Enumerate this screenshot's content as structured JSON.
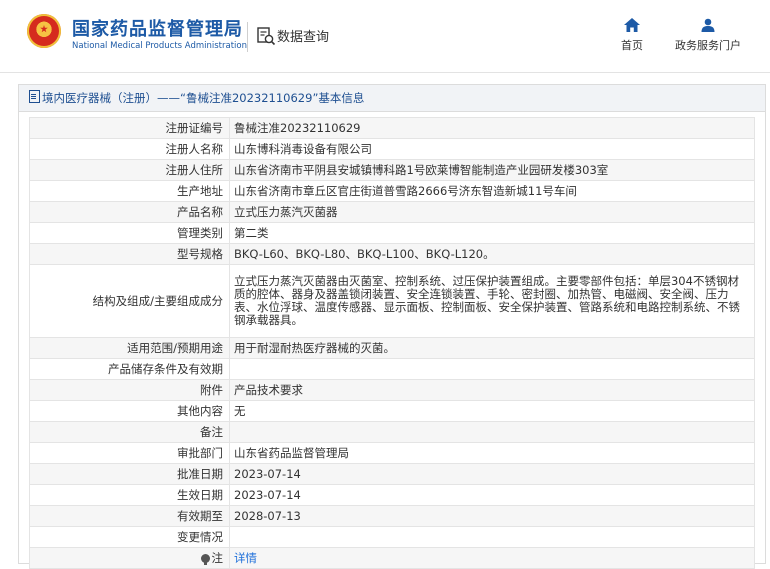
{
  "header": {
    "org_cn": "国家药品监督管理局",
    "org_en": "National Medical Products Administration",
    "query_label": "数据查询",
    "nav": {
      "home": "首页",
      "portal": "政务服务门户"
    }
  },
  "breadcrumb": "境内医疗器械（注册）——“鲁械注准20232110629”基本信息",
  "rows": [
    {
      "k": "注册证编号",
      "v": "鲁械注准20232110629"
    },
    {
      "k": "注册人名称",
      "v": "山东博科消毒设备有限公司"
    },
    {
      "k": "注册人住所",
      "v": "山东省济南市平阴县安城镇博科路1号欧莱博智能制造产业园研发楼303室"
    },
    {
      "k": "生产地址",
      "v": "山东省济南市章丘区官庄街道普雪路2666号济东智造新城11号车间"
    },
    {
      "k": "产品名称",
      "v": "立式压力蒸汽灭菌器"
    },
    {
      "k": "管理类别",
      "v": "第二类"
    },
    {
      "k": "型号规格",
      "v": "BKQ-L60、BKQ-L80、BKQ-L100、BKQ-L120。"
    },
    {
      "k": "结构及组成/主要组成成分",
      "v": "立式压力蒸汽灭菌器由灭菌室、控制系统、过压保护装置组成。主要零部件包括：单层304不锈钢材质的腔体、器身及器盖锁闭装置、安全连锁装置、手轮、密封圈、加热管、电磁阀、安全阀、压力表、水位浮球、温度传感器、显示面板、控制面板、安全保护装置、管路系统和电路控制系统、不锈钢承载器具。"
    },
    {
      "k": "适用范围/预期用途",
      "v": "用于耐湿耐热医疗器械的灭菌。"
    },
    {
      "k": "产品储存条件及有效期",
      "v": ""
    },
    {
      "k": "附件",
      "v": "产品技术要求"
    },
    {
      "k": "其他内容",
      "v": "无"
    },
    {
      "k": "备注",
      "v": ""
    },
    {
      "k": "审批部门",
      "v": "山东省药品监督管理局"
    },
    {
      "k": "批准日期",
      "v": "2023-07-14"
    },
    {
      "k": "生效日期",
      "v": "2023-07-14"
    },
    {
      "k": "有效期至",
      "v": "2028-07-13"
    },
    {
      "k": "变更情况",
      "v": ""
    },
    {
      "k": "注",
      "v": "详情"
    }
  ]
}
